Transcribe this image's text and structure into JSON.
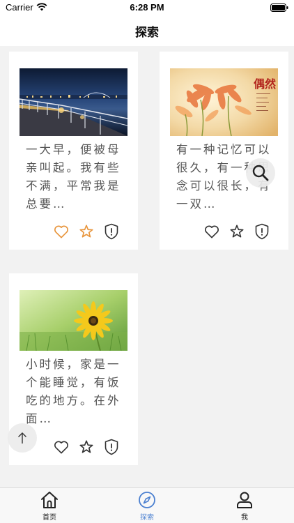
{
  "status_bar": {
    "carrier": "Carrier",
    "time": "6:28 PM"
  },
  "nav": {
    "title": "探索"
  },
  "cards": [
    {
      "excerpt": "一大早，便被母亲叫起。我有些不满，平常我是总要…",
      "photo": "night-pier-city-skyline",
      "liked": true,
      "favorited": true
    },
    {
      "excerpt": "有一种记忆可以很久，有一种思念可以很长，有一双…",
      "photo": "orange-flowers-calligraphy",
      "photo_caption": "偶然",
      "liked": false,
      "favorited": false
    },
    {
      "excerpt": "小时候，家是一个能睡觉，有饭吃的地方。在外面…",
      "photo": "yellow-daisy-green-field",
      "liked": false,
      "favorited": false
    }
  ],
  "icons": {
    "like": "heart-icon",
    "favorite": "star-icon",
    "report": "shield-exclamation-icon",
    "search": "magnifier-icon",
    "back_to_top": "arrow-up-icon"
  },
  "colors": {
    "accent_orange": "#e8943a",
    "tab_active": "#4a7fd0",
    "icon_default": "#333333",
    "background": "#f2f2f2"
  },
  "tabbar": {
    "tabs": [
      {
        "label": "首页",
        "icon": "home-icon",
        "active": false
      },
      {
        "label": "探索",
        "icon": "compass-icon",
        "active": true
      },
      {
        "label": "我",
        "icon": "person-icon",
        "active": false
      }
    ]
  }
}
